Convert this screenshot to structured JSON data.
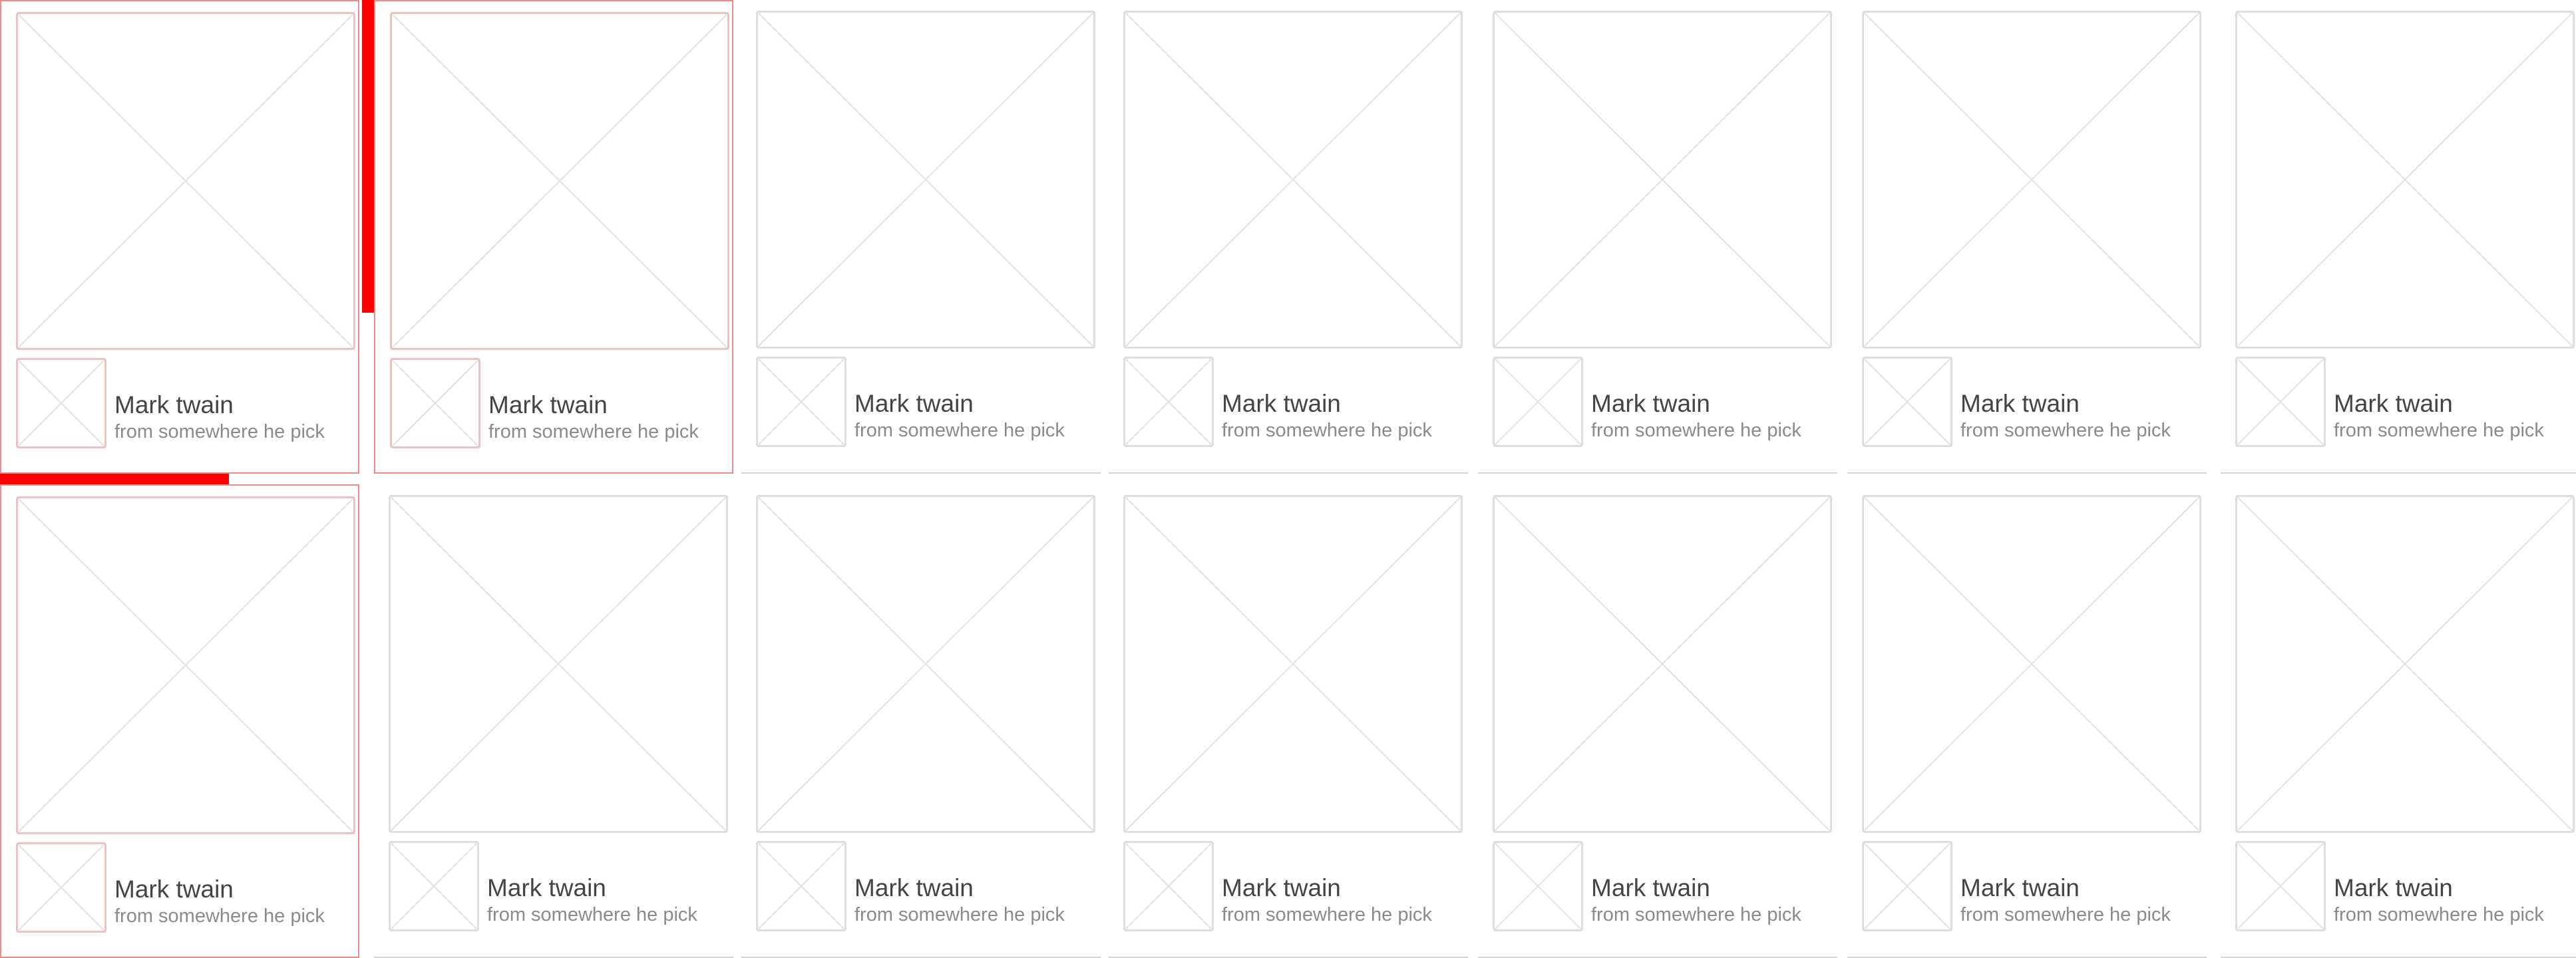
{
  "accent_color": "#ff0000",
  "selected_border_color": "#f08a8a",
  "placeholder_icon": "image-placeholder-icon",
  "avatar_icon": "avatar-placeholder-icon",
  "grid": {
    "rows": 2,
    "columns": 7,
    "selected_cards": [
      0,
      1,
      7
    ],
    "cards": [
      {
        "title": "Mark twain",
        "subtitle": "from somewhere he pick"
      },
      {
        "title": "Mark twain",
        "subtitle": "from somewhere he pick"
      },
      {
        "title": "Mark twain",
        "subtitle": "from somewhere he pick"
      },
      {
        "title": "Mark twain",
        "subtitle": "from somewhere he pick"
      },
      {
        "title": "Mark twain",
        "subtitle": "from somewhere he pick"
      },
      {
        "title": "Mark twain",
        "subtitle": "from somewhere he pick"
      },
      {
        "title": "Mark twain",
        "subtitle": "from somewhere he pick"
      },
      {
        "title": "Mark twain",
        "subtitle": "from somewhere he pick"
      },
      {
        "title": "Mark twain",
        "subtitle": "from somewhere he pick"
      },
      {
        "title": "Mark twain",
        "subtitle": "from somewhere he pick"
      },
      {
        "title": "Mark twain",
        "subtitle": "from somewhere he pick"
      },
      {
        "title": "Mark twain",
        "subtitle": "from somewhere he pick"
      },
      {
        "title": "Mark twain",
        "subtitle": "from somewhere he pick"
      },
      {
        "title": "Mark twain",
        "subtitle": "from somewhere he pick"
      }
    ]
  }
}
